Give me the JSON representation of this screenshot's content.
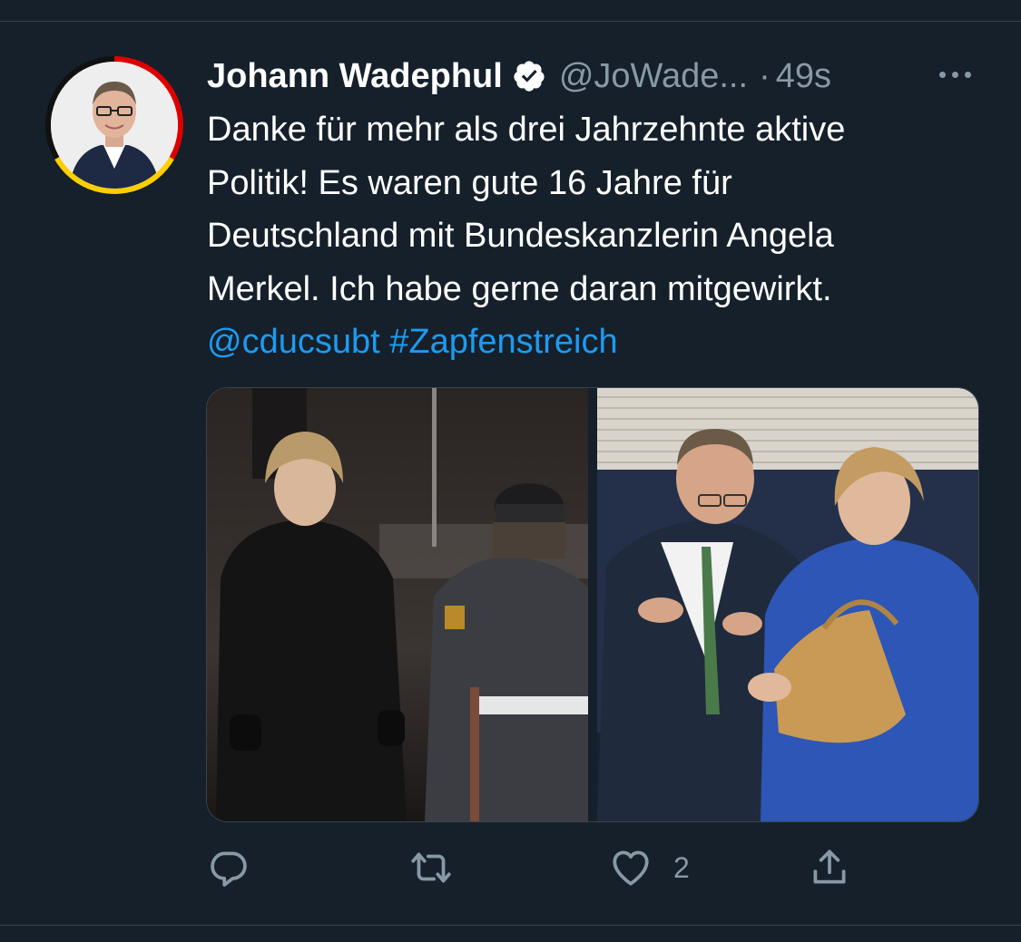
{
  "tweet": {
    "author_name": "Johann Wadephul",
    "handle": "@JoWade...",
    "separator": "·",
    "time": "49s",
    "text_lines": [
      "Danke für mehr als drei Jahrzehnte aktive",
      "Politik! Es waren gute 16 Jahre für",
      "Deutschland mit Bundeskanzlerin Angela",
      "Merkel. Ich habe gerne daran mitgewirkt."
    ],
    "mention": "@cducsubt",
    "hashtag": "#Zapfenstreich",
    "like_count": "2"
  },
  "icons": {
    "verified": "verified-badge-icon",
    "more": "more-options-icon",
    "reply": "reply-icon",
    "retweet": "retweet-icon",
    "like": "heart-icon",
    "share": "share-icon"
  },
  "colors": {
    "background": "#15202b",
    "text": "#ffffff",
    "secondary": "#8899a6",
    "link": "#1d9bf0",
    "divider": "#38444d"
  }
}
